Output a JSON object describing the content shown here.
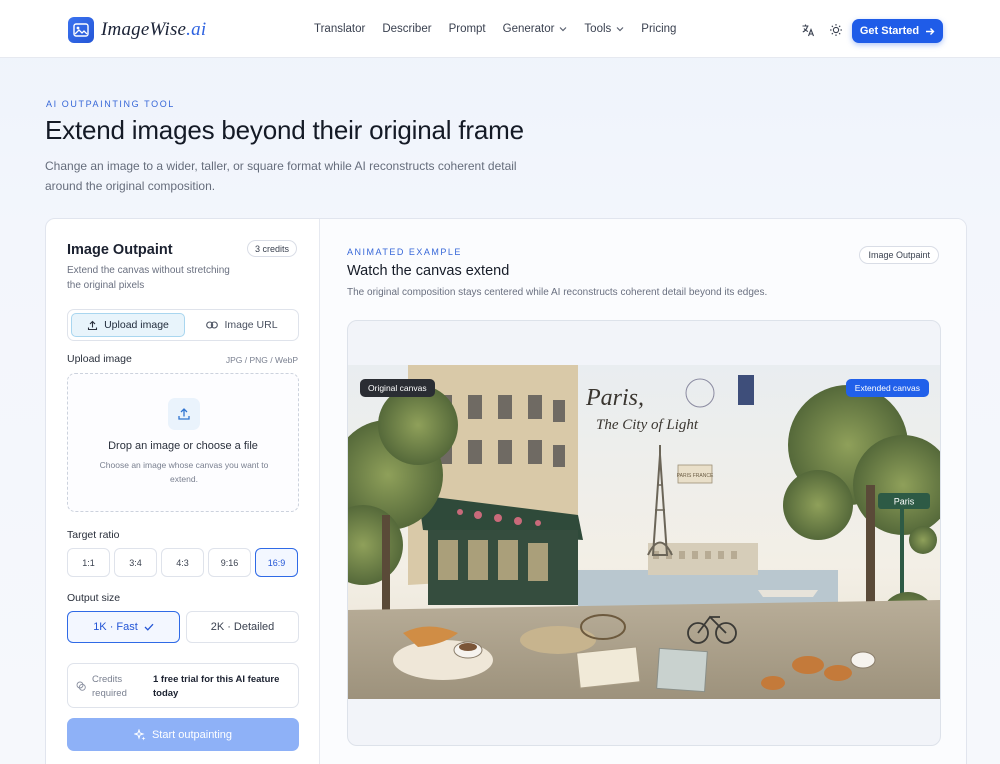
{
  "header": {
    "logo_name": "ImageWise",
    "logo_suffix": ".ai",
    "nav": [
      {
        "label": "Translator"
      },
      {
        "label": "Describer"
      },
      {
        "label": "Prompt"
      },
      {
        "label": "Generator",
        "has_dropdown": true
      },
      {
        "label": "Tools",
        "has_dropdown": true
      },
      {
        "label": "Pricing"
      }
    ],
    "cta_label": "Get Started"
  },
  "hero": {
    "eyebrow": "AI OUTPAINTING TOOL",
    "title": "Extend images beyond their original frame",
    "subtitle": "Change an image to a wider, taller, or square format while AI reconstructs coherent detail around the original composition."
  },
  "tool": {
    "title": "Image Outpaint",
    "credits_badge": "3 credits",
    "description": "Extend the canvas without stretching the original pixels",
    "source_tabs": [
      {
        "label": "Upload image",
        "icon": "upload-icon",
        "active": true
      },
      {
        "label": "Image URL",
        "icon": "link-icon",
        "active": false
      }
    ],
    "upload_label": "Upload image",
    "upload_formats": "JPG / PNG / WebP",
    "dropzone_title": "Drop an image or choose a file",
    "dropzone_subtitle": "Choose an image whose canvas you want to extend.",
    "ratio_label": "Target ratio",
    "ratios": [
      "1:1",
      "3:4",
      "4:3",
      "9:16",
      "16:9"
    ],
    "selected_ratio": "16:9",
    "size_label": "Output size",
    "sizes": [
      {
        "label": "1K · Fast",
        "active": true
      },
      {
        "label": "2K · Detailed",
        "active": false
      }
    ],
    "credits_required_label": "Credits required",
    "credits_required_value": "1 free trial for this AI feature today",
    "start_button": "Start outpainting"
  },
  "example": {
    "eyebrow": "ANIMATED EXAMPLE",
    "title": "Watch the canvas extend",
    "subtitle": "The original composition stays centered while AI reconstructs coherent detail beyond its edges.",
    "badge": "Image Outpaint",
    "label_original": "Original canvas",
    "label_extended": "Extended canvas",
    "art_heading_1": "Paris,",
    "art_heading_2": "The City of Light",
    "art_postmark": "PARIS FRANCE",
    "art_sign": "Paris"
  },
  "colors": {
    "accent": "#1f5ce8",
    "eyebrow": "#3767d8",
    "selected_border": "#2f6ae6",
    "start_button_disabled": "#8eb1f7"
  }
}
